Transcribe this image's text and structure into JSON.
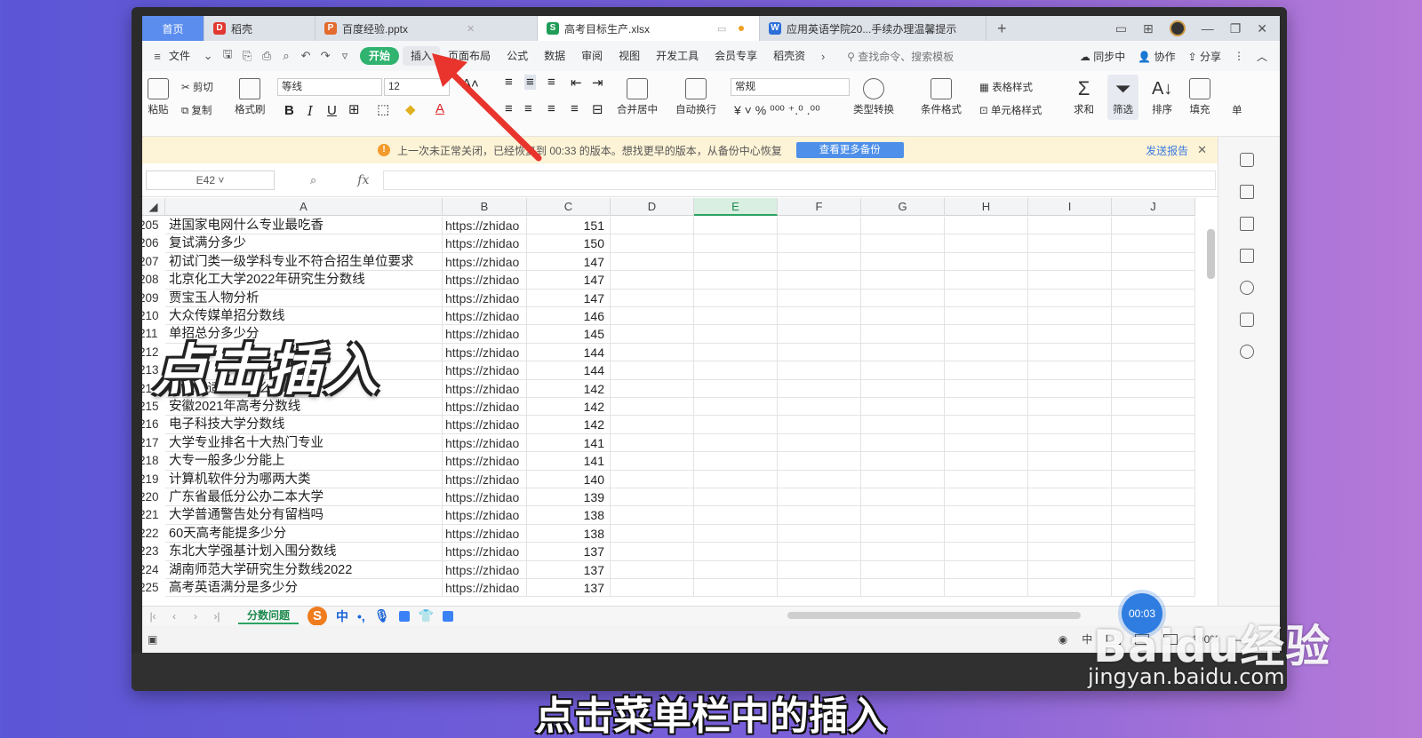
{
  "tabs": [
    {
      "label": "首页",
      "kind": "home"
    },
    {
      "label": "稻壳",
      "icon_color": "#e2382f",
      "icon_glyph": "D"
    },
    {
      "label": "百度经验.pptx",
      "icon_color": "#e36b2d",
      "icon_glyph": "P"
    },
    {
      "label": "高考目标生产.xlsx",
      "icon_color": "#1f9d57",
      "icon_glyph": "S",
      "active": true
    },
    {
      "label": "应用英语学院20...手续办理温馨提示",
      "icon_color": "#2d6fd8",
      "icon_glyph": "W"
    }
  ],
  "menu": {
    "file": "文件",
    "items": [
      "开始",
      "插入",
      "页面布局",
      "公式",
      "数据",
      "审阅",
      "视图",
      "开发工具",
      "会员专享",
      "稻壳资"
    ],
    "search": "查找命令、搜索模板",
    "sync": "同步中",
    "collab": "协作",
    "share": "分享"
  },
  "ribbon": {
    "paste": "粘贴",
    "cut": "剪切",
    "copy": "复制",
    "format_painter": "格式刷",
    "font_name": "等线",
    "font_size": "12",
    "merge": "合并居中",
    "wrap": "自动换行",
    "number_format": "常规",
    "type_convert": "类型转换",
    "cond_format": "条件格式",
    "table_style": "表格样式",
    "cell_style": "单元格样式",
    "sum": "求和",
    "filter": "筛选",
    "sort": "排序",
    "fill": "填充",
    "single": "单"
  },
  "warning": {
    "text": "上一次未正常关闭，已经恢复到 00:33 的版本。想找更早的版本，从备份中心恢复",
    "button": "查看更多备份",
    "report": "发送报告"
  },
  "formula": {
    "cell_ref": "E42",
    "fx": "fx",
    "value": ""
  },
  "columns": [
    "A",
    "B",
    "C",
    "D",
    "E",
    "F",
    "G",
    "H",
    "I",
    "J"
  ],
  "selected_column": "E",
  "rows": [
    {
      "n": "205",
      "a": "进国家电网什么专业最吃香",
      "b": "https://zhidao",
      "c": "151"
    },
    {
      "n": "206",
      "a": "复试满分多少",
      "b": "https://zhidao",
      "c": "150"
    },
    {
      "n": "207",
      "a": "初试门类一级学科专业不符合招生单位要求",
      "b": "https://zhidao",
      "c": "147"
    },
    {
      "n": "208",
      "a": "北京化工大学2022年研究生分数线",
      "b": "https://zhidao",
      "c": "147"
    },
    {
      "n": "209",
      "a": "贾宝玉人物分析",
      "b": "https://zhidao",
      "c": "147"
    },
    {
      "n": "210",
      "a": "大众传媒单招分数线",
      "b": "https://zhidao",
      "c": "146"
    },
    {
      "n": "211",
      "a": "单招总分多少分",
      "b": "https://zhidao",
      "c": "145"
    },
    {
      "n": "212",
      "a": "",
      "b": "https://zhidao",
      "c": "144"
    },
    {
      "n": "213",
      "a": "",
      "b": "https://zhidao",
      "c": "144"
    },
    {
      "n": "214",
      "a": "测试你适合读什么专业",
      "b": "https://zhidao",
      "c": "142"
    },
    {
      "n": "215",
      "a": "安徽2021年高考分数线",
      "b": "https://zhidao",
      "c": "142"
    },
    {
      "n": "216",
      "a": "电子科技大学分数线",
      "b": "https://zhidao",
      "c": "142"
    },
    {
      "n": "217",
      "a": "大学专业排名十大热门专业",
      "b": "https://zhidao",
      "c": "141"
    },
    {
      "n": "218",
      "a": "大专一般多少分能上",
      "b": "https://zhidao",
      "c": "141"
    },
    {
      "n": "219",
      "a": "计算机软件分为哪两大类",
      "b": "https://zhidao",
      "c": "140"
    },
    {
      "n": "220",
      "a": "广东省最低分公办二本大学",
      "b": "https://zhidao",
      "c": "139"
    },
    {
      "n": "221",
      "a": "大学普通警告处分有留档吗",
      "b": "https://zhidao",
      "c": "138"
    },
    {
      "n": "222",
      "a": "60天高考能提多少分",
      "b": "https://zhidao",
      "c": "138"
    },
    {
      "n": "223",
      "a": "东北大学强基计划入围分数线",
      "b": "https://zhidao",
      "c": "137"
    },
    {
      "n": "224",
      "a": "湖南师范大学研究生分数线2022",
      "b": "https://zhidao",
      "c": "137"
    },
    {
      "n": "225",
      "a": "高考英语满分是多少分",
      "b": "https://zhidao",
      "c": "137"
    }
  ],
  "sheet_tab": "分数问题",
  "ime": {
    "zh": "中"
  },
  "status": {
    "zoom": "100%",
    "lang": "中"
  },
  "overlay_text": "点击插入",
  "caption": "点击菜单栏中的插入",
  "timer": "00:03",
  "watermark": {
    "logo": "Baidu经验",
    "url": "jingyan.baidu.com"
  },
  "colors": {
    "accent_green": "#2fb36e",
    "arrow_red": "#e8342c",
    "warn_bg": "#fdf3d6"
  }
}
